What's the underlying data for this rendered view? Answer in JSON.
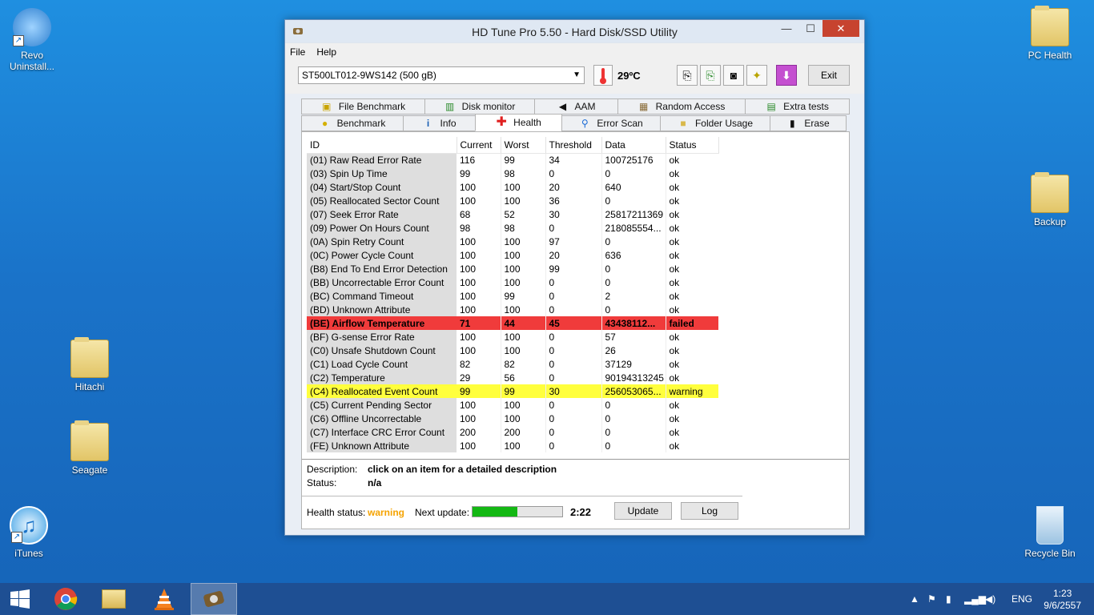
{
  "desktop": {
    "icons": [
      {
        "label": "Revo Uninstall..."
      },
      {
        "label": "Hitachi"
      },
      {
        "label": "Seagate"
      },
      {
        "label": "iTunes"
      },
      {
        "label": "PC Health"
      },
      {
        "label": "Backup"
      },
      {
        "label": "Recycle Bin"
      }
    ]
  },
  "window": {
    "title": "HD Tune Pro 5.50 - Hard Disk/SSD Utility",
    "controls": {
      "minimize": "—",
      "maximize": "☐",
      "close": "✕"
    }
  },
  "menu": {
    "file": "File",
    "help": "Help"
  },
  "toolbar": {
    "drive": "ST500LT012-9WS142 (500 gB)",
    "temperature": "29ºC",
    "exit_label": "Exit"
  },
  "tabs": {
    "row1": [
      "File Benchmark",
      "Disk monitor",
      "AAM",
      "Random Access",
      "Extra tests"
    ],
    "row2": [
      "Benchmark",
      "Info",
      "Health",
      "Error Scan",
      "Folder Usage",
      "Erase"
    ],
    "active": "Health"
  },
  "smart": {
    "columns": [
      "ID",
      "Current",
      "Worst",
      "Threshold",
      "Data",
      "Status"
    ],
    "rows": [
      [
        "(01) Raw Read Error Rate",
        "116",
        "99",
        "34",
        "100725176",
        "ok"
      ],
      [
        "(03) Spin Up Time",
        "99",
        "98",
        "0",
        "0",
        "ok"
      ],
      [
        "(04) Start/Stop Count",
        "100",
        "100",
        "20",
        "640",
        "ok"
      ],
      [
        "(05) Reallocated Sector Count",
        "100",
        "100",
        "36",
        "0",
        "ok"
      ],
      [
        "(07) Seek Error Rate",
        "68",
        "52",
        "30",
        "25817211369",
        "ok"
      ],
      [
        "(09) Power On Hours Count",
        "98",
        "98",
        "0",
        "218085554...",
        "ok"
      ],
      [
        "(0A) Spin Retry Count",
        "100",
        "100",
        "97",
        "0",
        "ok"
      ],
      [
        "(0C) Power Cycle Count",
        "100",
        "100",
        "20",
        "636",
        "ok"
      ],
      [
        "(B8) End To End Error Detection",
        "100",
        "100",
        "99",
        "0",
        "ok"
      ],
      [
        "(BB) Uncorrectable Error Count",
        "100",
        "100",
        "0",
        "0",
        "ok"
      ],
      [
        "(BC) Command Timeout",
        "100",
        "99",
        "0",
        "2",
        "ok"
      ],
      [
        "(BD) Unknown Attribute",
        "100",
        "100",
        "0",
        "0",
        "ok"
      ],
      [
        "(BE) Airflow Temperature",
        "71",
        "44",
        "45",
        "43438112...",
        "failed"
      ],
      [
        "(BF) G-sense Error Rate",
        "100",
        "100",
        "0",
        "57",
        "ok"
      ],
      [
        "(C0) Unsafe Shutdown Count",
        "100",
        "100",
        "0",
        "26",
        "ok"
      ],
      [
        "(C1) Load Cycle Count",
        "82",
        "82",
        "0",
        "37129",
        "ok"
      ],
      [
        "(C2) Temperature",
        "29",
        "56",
        "0",
        "90194313245",
        "ok"
      ],
      [
        "(C4) Reallocated Event Count",
        "99",
        "99",
        "30",
        "256053065...",
        "warning"
      ],
      [
        "(C5) Current Pending Sector",
        "100",
        "100",
        "0",
        "0",
        "ok"
      ],
      [
        "(C6) Offline Uncorrectable",
        "100",
        "100",
        "0",
        "0",
        "ok"
      ],
      [
        "(C7) Interface CRC Error Count",
        "200",
        "200",
        "0",
        "0",
        "ok"
      ],
      [
        "(FE) Unknown Attribute",
        "100",
        "100",
        "0",
        "0",
        "ok"
      ]
    ]
  },
  "details": {
    "description_label": "Description:",
    "description_value": "click on an item for a detailed description",
    "status_label": "Status:",
    "status_value": "n/a"
  },
  "health": {
    "label": "Health status:",
    "value": "warning",
    "next_update_label": "Next update:",
    "progress_fraction": 0.5,
    "countdown": "2:22",
    "update_label": "Update",
    "log_label": "Log"
  },
  "taskbar": {
    "language": "ENG",
    "time": "1:23",
    "date": "9/6/2557"
  },
  "colors": {
    "failed": "#f03b3b",
    "warning": "#ffff3d",
    "health_warning": "#f5a300",
    "progress": "#14b814"
  }
}
